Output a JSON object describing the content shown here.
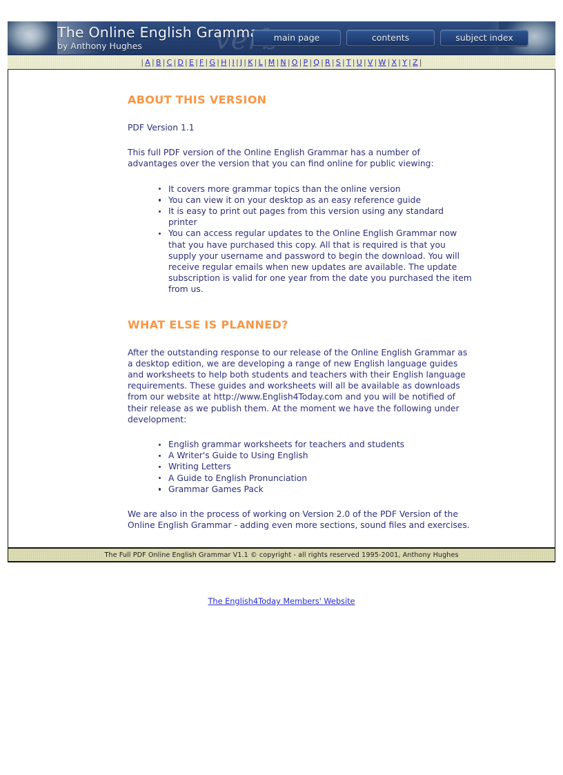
{
  "banner": {
    "title": "The Online English Grammar",
    "subtitle": "by Anthony Hughes",
    "watermark": "verb",
    "nav": [
      {
        "label": "main page",
        "name": "main-page"
      },
      {
        "label": "contents",
        "name": "contents"
      },
      {
        "label": "subject index",
        "name": "subject-index"
      }
    ]
  },
  "alpha_index": {
    "separator": "|",
    "letters": [
      "A",
      "B",
      "C",
      "D",
      "E",
      "F",
      "G",
      "H",
      "I",
      "J",
      "K",
      "L",
      "M",
      "N",
      "O",
      "P",
      "Q",
      "R",
      "S",
      "T",
      "U",
      "V",
      "W",
      "X",
      "Y",
      "Z"
    ]
  },
  "main": {
    "section1": {
      "heading": "ABOUT THIS VERSION",
      "version_line": "PDF Version 1.1",
      "intro": "This full PDF version of the Online English Grammar has a number of advantages over the version that you can find online for public viewing:",
      "bullets": [
        "It covers more grammar topics than the online version",
        "You can view it on your desktop as an easy reference guide",
        "It is easy to print out pages from this version using any standard printer",
        "You can access regular updates to the Online English Grammar now that you have purchased this copy. All that is required is that you supply your username and password to begin the download. You will receive regular emails when new updates are available. The update subscription is valid for one year from the date you purchased the item from us."
      ]
    },
    "section2": {
      "heading": "WHAT ELSE IS PLANNED?",
      "intro": "After the outstanding response to our release of the Online English Grammar as a desktop edition, we are developing a range of new English language guides and worksheets to help both students and teachers with their English language requirements. These guides and worksheets will all be available as downloads from our website at http://www.English4Today.com and you will be notified of their release as we publish them. At the moment we have the following under development:",
      "bullets": [
        "English grammar worksheets for teachers and students",
        "A Writer's Guide to Using English",
        "Writing Letters",
        "A Guide to English Pronunciation",
        "Grammar Games Pack"
      ],
      "closing": "We are also in the process of working on Version 2.0 of the PDF Version of the Online English Grammar - adding even more sections, sound files and exercises."
    }
  },
  "footer": {
    "copyright": "The Full PDF Online English Grammar V1.1 © copyright - all rights reserved 1995-2001, Anthony Hughes",
    "bottom_link": "The English4Today Members' Website"
  },
  "colors": {
    "heading_orange": "#f79646",
    "body_blue": "#2b2f7a",
    "link_blue": "#2a2ad0",
    "banner_blue": "#1b3a6b",
    "bar_cream": "#e8e8c8",
    "footer_olive": "#d6d6a8"
  }
}
